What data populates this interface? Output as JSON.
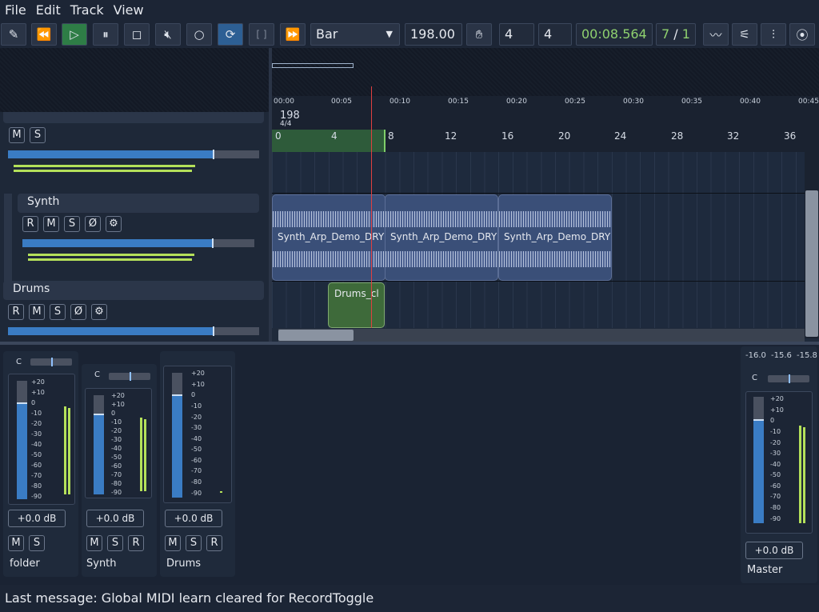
{
  "menu": {
    "file": "File",
    "edit": "Edit",
    "track": "Track",
    "view": "View"
  },
  "toolbar": {
    "snap_mode": "Bar",
    "bpm": "198.00",
    "time_sig_num": "4",
    "time_sig_den": "4",
    "time": "00:08.564",
    "position": "7",
    "position_sep": "/",
    "position_beat": "1",
    "loop_bracket": "[ ]"
  },
  "ruler": {
    "times": [
      "00:00",
      "00:05",
      "00:10",
      "00:15",
      "00:20",
      "00:25",
      "00:30",
      "00:35",
      "00:40",
      "00:45"
    ],
    "tempo": "198",
    "signature": "4/4",
    "bars": [
      "0",
      "4",
      "8",
      "12",
      "16",
      "20",
      "24",
      "28",
      "32",
      "36"
    ]
  },
  "tracks": {
    "folder": {
      "name": "folder",
      "mute": "M",
      "solo": "S"
    },
    "synth": {
      "name": "Synth",
      "record": "R",
      "mute": "M",
      "solo": "S",
      "phase": "Ø"
    },
    "drums": {
      "name": "Drums",
      "record": "R",
      "mute": "M",
      "solo": "S",
      "phase": "Ø"
    }
  },
  "clips": {
    "synth_1": "Synth_Arp_Demo_DRY",
    "synth_2": "Synth_Arp_Demo_DRY",
    "synth_3": "Synth_Arp_Demo_DRY",
    "drums_1": "Drums_cl"
  },
  "mixer": {
    "db_scale": [
      "+20",
      "+10",
      "0",
      "-10",
      "-20",
      "-30",
      "-40",
      "-50",
      "-60",
      "-70",
      "-80",
      "-90"
    ],
    "pan_label": "C",
    "strips": [
      {
        "name": "folder",
        "volume": "+0.0 dB",
        "btn1": "M",
        "btn2": "S"
      },
      {
        "name": "Synth",
        "volume": "+0.0 dB",
        "btn1": "M",
        "btn2": "S",
        "btn3": "R"
      },
      {
        "name": "Drums",
        "volume": "+0.0 dB",
        "btn1": "M",
        "btn2": "S",
        "btn3": "R"
      }
    ],
    "master": {
      "name": "Master",
      "volume": "+0.0 dB",
      "peak1": "-16.0",
      "peak2": "-15.6",
      "peak3": "-15.8"
    }
  },
  "status": {
    "message": "Last message: Global MIDI learn cleared for RecordToggle"
  },
  "colors": {
    "accent": "#3a7cc4",
    "play": "#2e7d46",
    "loop": "#2d5f94",
    "meter": "#b4e05a",
    "playhead": "#e04040",
    "clip": "#3a4f78",
    "midi_clip": "#3e6a3a"
  }
}
